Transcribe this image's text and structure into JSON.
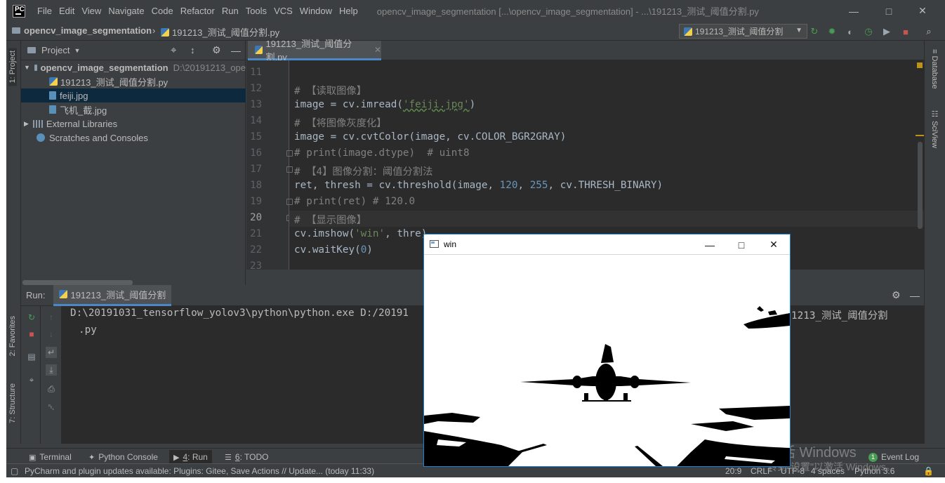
{
  "menu": {
    "items": [
      "File",
      "Edit",
      "View",
      "Navigate",
      "Code",
      "Refactor",
      "Run",
      "Tools",
      "VCS",
      "Window",
      "Help"
    ],
    "window_title": "opencv_image_segmentation [...\\opencv_image_segmentation] - ...\\191213_测试_阈值分割.py"
  },
  "navbar": {
    "project": "opencv_image_segmentation",
    "file": "191213_测试_阈值分割.py",
    "run_config": "191213_测试_阈值分割"
  },
  "side_tabs": {
    "project": "1: Project",
    "favorites": "2: Favorites",
    "structure": "7: Structure",
    "database": "Database",
    "sciview": "SciView"
  },
  "project_panel": {
    "title": "Project",
    "root_name": "opencv_image_segmentation",
    "root_path": "D:\\20191213_ope",
    "files": [
      "191213_测试_阈值分割.py",
      "feiji.jpg",
      "飞机_截.jpg"
    ],
    "external_libraries": "External Libraries",
    "scratches": "Scratches and Consoles"
  },
  "editor": {
    "tab_label": "191213_测试_阈值分割.py",
    "line_numbers": [
      "11",
      "12",
      "13",
      "14",
      "15",
      "16",
      "17",
      "18",
      "19",
      "20",
      "21",
      "22",
      "23"
    ],
    "current_line": "20",
    "lines": {
      "l12": "# 【读取图像】",
      "l13_a": "image = cv.imread(",
      "l13_str": "'feiji.jpg'",
      "l13_b": ")",
      "l14": "# 【将图像灰度化】",
      "l15": "image = cv.cvtColor(image, cv.COLOR_BGR2GRAY)",
      "l16": "# print(image.dtype)  # uint8",
      "l17": "# 【4】图像分割：阈值分割法",
      "l18_a": "ret, thresh = cv.threshold(image, ",
      "l18_n1": "120",
      "l18_c": ", ",
      "l18_n2": "255",
      "l18_d": ", cv.THRESH_BINARY)",
      "l19": "# print(ret) # 120.0",
      "l20": "# 【显示图像】",
      "l21_a": "cv.imshow(",
      "l21_str": "'win'",
      "l21_b": ", thre",
      "l21_c": ")",
      "l22_a": "cv.waitKey(",
      "l22_n": "0",
      "l22_b": ")"
    }
  },
  "run_panel": {
    "label": "Run:",
    "config": "191213_测试_阈值分割",
    "console_line1": "D:\\20191031_tensorflow_yolov3\\python\\python.exe D:/20191",
    "console_line1_tail": "1213_测试_阈值分割",
    "console_line2": ".py"
  },
  "bottom_tabs": {
    "terminal": "Terminal",
    "python_console": "Python Console",
    "run_num": "4",
    "run": ": Run",
    "todo_num": "6",
    "todo": ": TODO",
    "event_count": "1",
    "event_log": "Event Log"
  },
  "status": {
    "message": "PyCharm and plugin updates available: Plugins: Gitee, Save Actions // Update... (today 11:33)",
    "position": "20:9",
    "line_sep": "CRLF",
    "encoding": "UTF-8",
    "indent": "4 spaces",
    "interpreter": "Python 3.6"
  },
  "watermark": {
    "line1": "激活 Windows",
    "line2": "转到\"设置\"以激活 Windows。"
  },
  "cv_window": {
    "title": "win"
  },
  "colors": {
    "editor_bg": "#2b2b2b",
    "panel_bg": "#3c3f41",
    "comment": "#808080",
    "string": "#6a8759",
    "number": "#6897bb",
    "accent": "#4a88c7"
  }
}
